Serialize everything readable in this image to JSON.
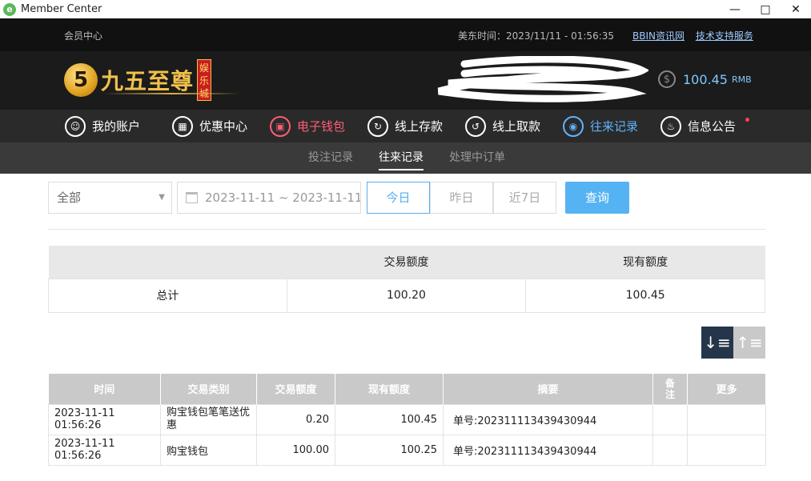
{
  "window": {
    "title": "Member Center",
    "icon": "e"
  },
  "topbar": {
    "member_center": "会员中心",
    "time_text": "美东时间：2023/11/11 - 01:56:35",
    "link_news": "BBIN资讯网",
    "link_support": "技术支持服务"
  },
  "header": {
    "logo_text": "九五至尊",
    "logo_mark": "5",
    "logo_badge": "娱乐城",
    "balance_amount": "100.45",
    "balance_currency": "RMB"
  },
  "nav": [
    {
      "label": "我的账户",
      "icon": "user-icon"
    },
    {
      "label": "优惠中心",
      "icon": "gift-icon"
    },
    {
      "label": "电子钱包",
      "icon": "wallet-icon"
    },
    {
      "label": "线上存款",
      "icon": "deposit-icon"
    },
    {
      "label": "线上取款",
      "icon": "withdraw-icon"
    },
    {
      "label": "往来记录",
      "icon": "records-icon"
    },
    {
      "label": "信息公告",
      "icon": "bell-icon"
    }
  ],
  "subnav": {
    "tab1": "投注记录",
    "tab2": "往来记录",
    "tab3": "处理中订单"
  },
  "filter": {
    "type_value": "全部",
    "date_range": "2023-11-11 ~ 2023-11-11",
    "today": "今日",
    "yesterday": "昨日",
    "last7": "近7日",
    "query": "查询"
  },
  "summary": {
    "col_amount": "交易额度",
    "col_balance": "现有额度",
    "total_label": "总计",
    "total_amount": "100.20",
    "total_balance": "100.45"
  },
  "records": {
    "headers": {
      "time": "时间",
      "type": "交易类别",
      "amount": "交易额度",
      "balance": "现有额度",
      "summary": "摘要",
      "note": "备注",
      "more": "更多"
    },
    "rows": [
      {
        "time": "2023-11-11 01:56:26",
        "type": "购宝钱包笔笔送优惠",
        "amount": "0.20",
        "balance": "100.45",
        "summary": "单号:202311113439430944",
        "note": "",
        "more": ""
      },
      {
        "time": "2023-11-11 01:56:26",
        "type": "购宝钱包",
        "amount": "100.00",
        "balance": "100.25",
        "summary": "单号:202311113439430944",
        "note": "",
        "more": ""
      }
    ]
  },
  "colors": {
    "accent_blue": "#56b3f3",
    "active_red": "#ff5d77",
    "active_blue": "#5fb4ff",
    "logo_gold": "#f0c14a"
  }
}
